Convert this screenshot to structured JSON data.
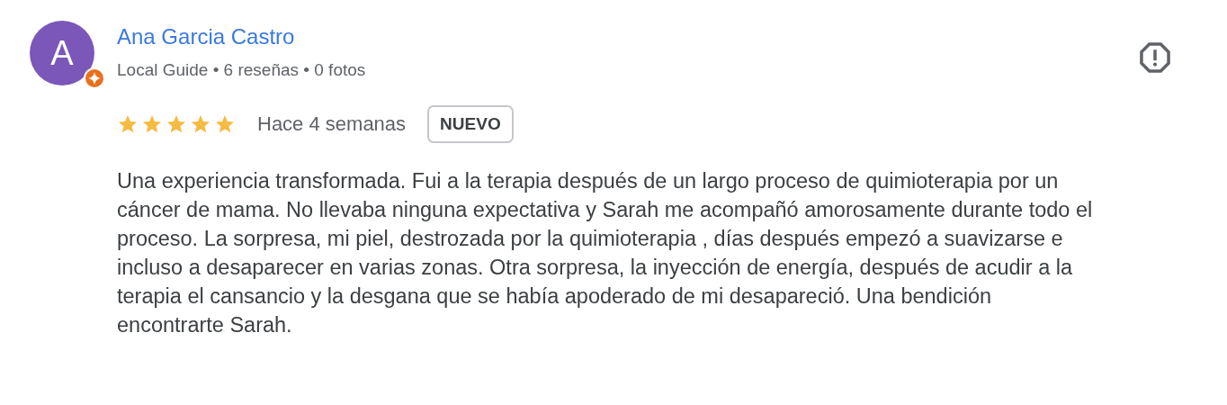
{
  "review": {
    "avatar_letter": "A",
    "author": "Ana Garcia Castro",
    "local_guide": true,
    "meta": "Local Guide • 6 reseñas • 0 fotos",
    "stars": 5,
    "time": "Hace 4 semanas",
    "badge": "NUEVO",
    "text": "Una experiencia transformada. Fui a la terapia después de un largo proceso de quimioterapia por un cáncer de mama. No llevaba ninguna expectativa y Sarah me acompañó amorosamente durante todo el proceso. La sorpresa, mi piel, destrozada por la quimioterapia , días después empezó a suavizarse e incluso a desaparecer en varias zonas. Otra sorpresa, la inyección de energía, después de acudir a la terapia el cansancio y la desgana que se había apoderado de mi desapareció. Una bendición encontrarte Sarah."
  }
}
